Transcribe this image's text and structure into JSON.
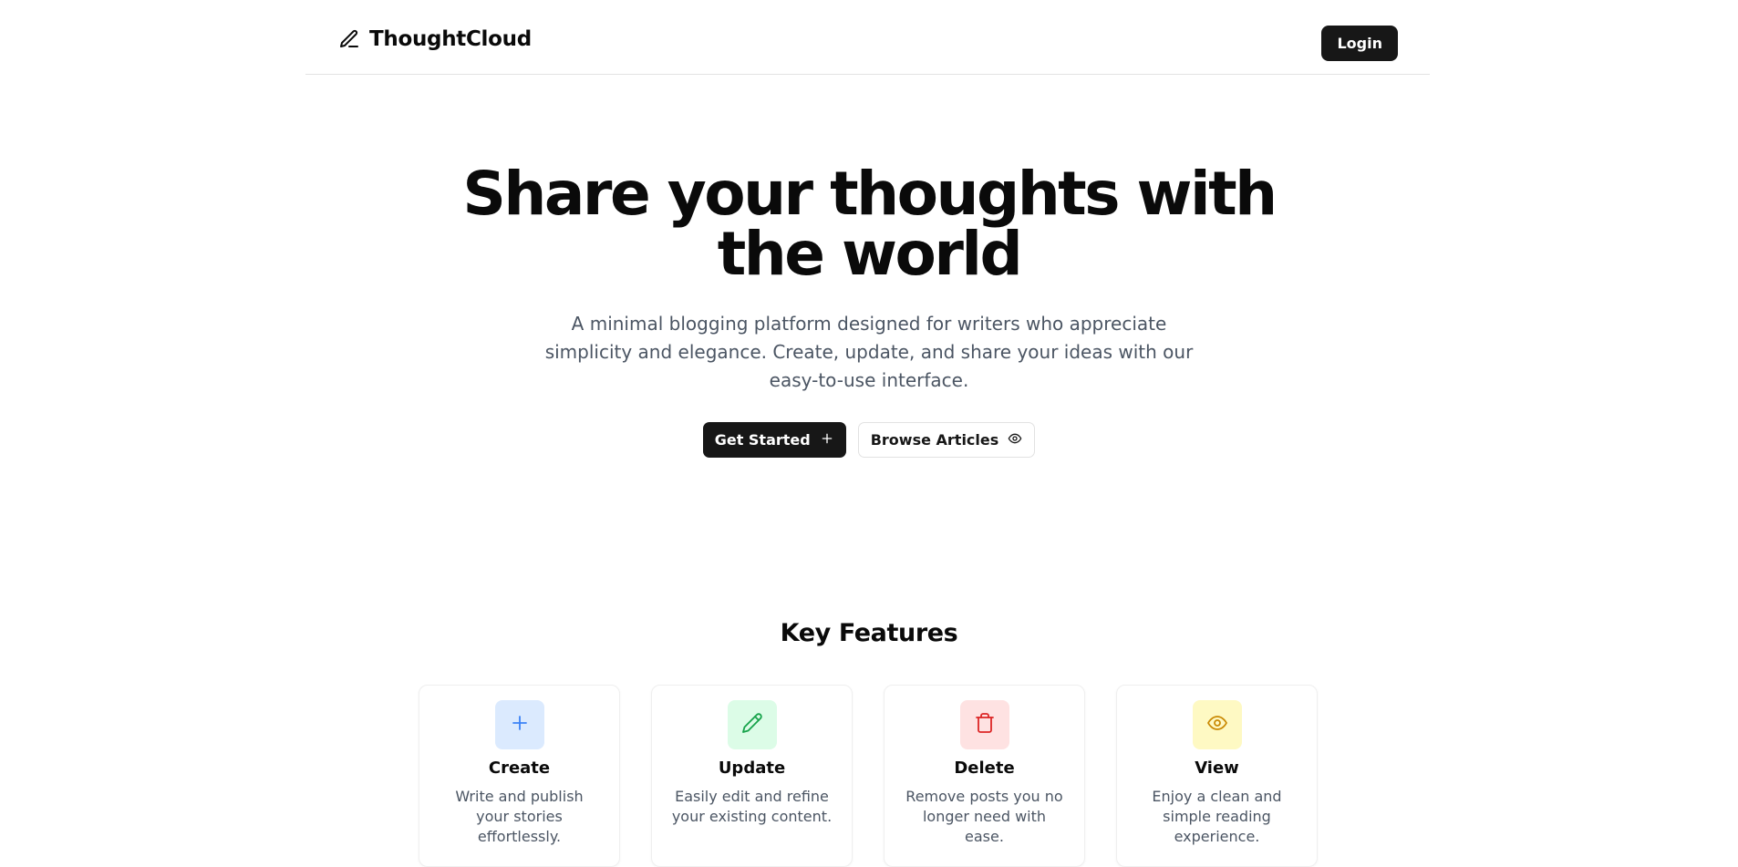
{
  "header": {
    "brand_icon": "pen-icon",
    "brand_name": "ThoughtCloud",
    "login_label": "Login"
  },
  "hero": {
    "title": "Share your thoughts with the world",
    "subtitle": "A minimal blogging platform designed for writers who appreciate simplicity and elegance. Create, update, and share your ideas with our easy-to-use interface.",
    "primary_cta": {
      "label": "Get Started",
      "icon": "plus-icon"
    },
    "secondary_cta": {
      "label": "Browse Articles",
      "icon": "eye-icon"
    }
  },
  "features": {
    "title": "Key Features",
    "items": [
      {
        "title": "Create",
        "description": "Write and publish your stories effortlessly.",
        "icon": "plus-icon",
        "bg": "#dbeafe",
        "fg": "#3b82f6"
      },
      {
        "title": "Update",
        "description": "Easily edit and refine your existing content.",
        "icon": "pencil-icon",
        "bg": "#dcfce7",
        "fg": "#16a34a"
      },
      {
        "title": "Delete",
        "description": "Remove posts you no longer need with ease.",
        "icon": "trash-icon",
        "bg": "#fee2e2",
        "fg": "#dc2626"
      },
      {
        "title": "View",
        "description": "Enjoy a clean and simple reading experience.",
        "icon": "eye-icon",
        "bg": "#fef9c3",
        "fg": "#ca8a04"
      }
    ]
  },
  "colors": {
    "primary": "#171717",
    "border": "#e2e2e2",
    "muted_text": "#4b5563"
  }
}
